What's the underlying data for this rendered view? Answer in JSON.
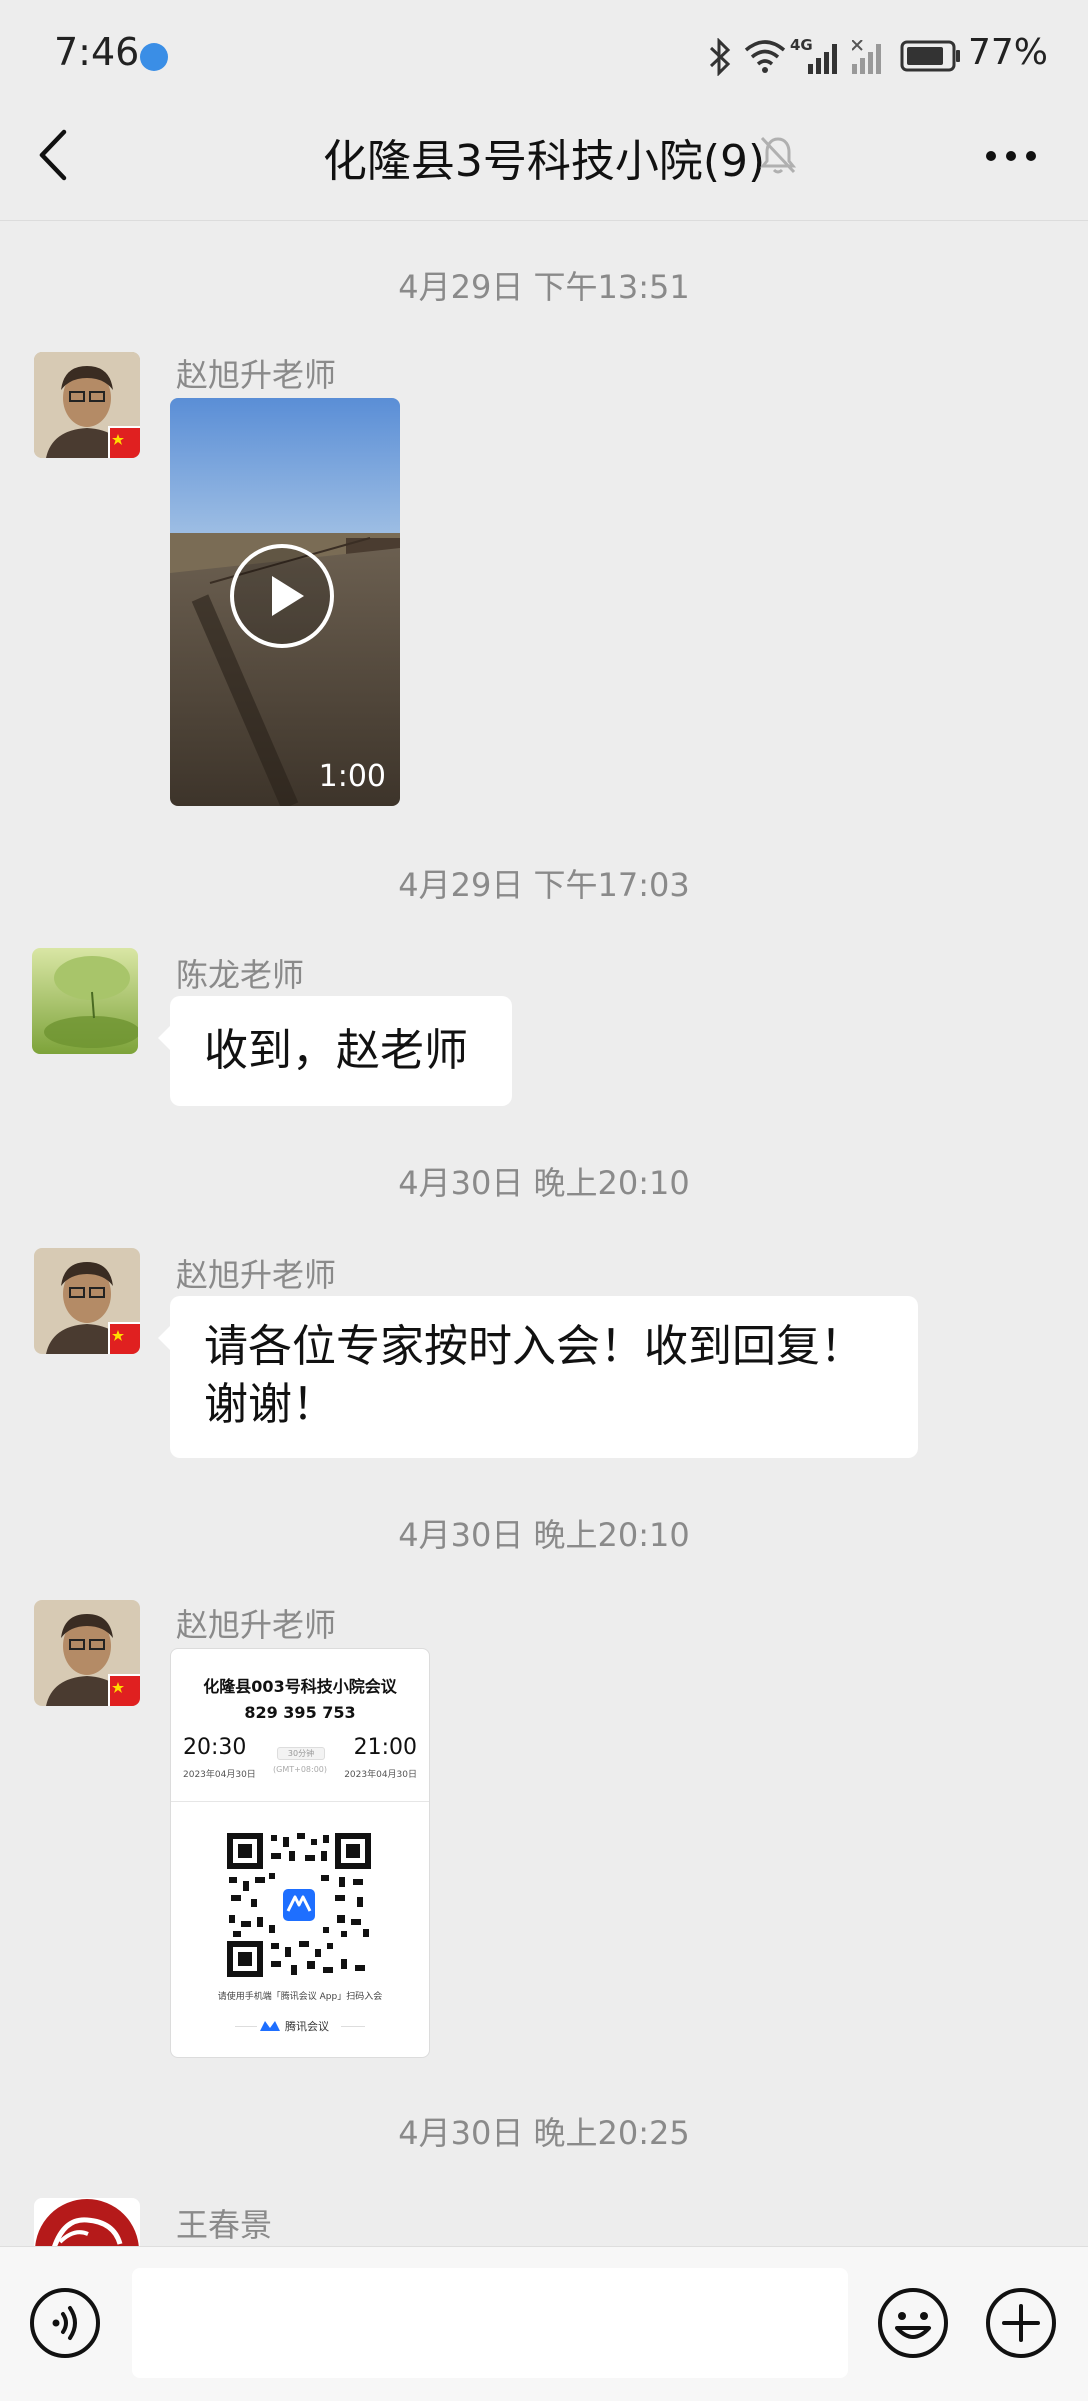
{
  "status_bar": {
    "time": "7:46",
    "network": "4G",
    "battery": "77%"
  },
  "nav": {
    "title": "化隆县3号科技小院(9)"
  },
  "messages": [
    {
      "type": "timestamp",
      "text": "4月29日 下午13:51"
    },
    {
      "type": "video",
      "sender": "赵旭升老师",
      "duration": "1:00"
    },
    {
      "type": "timestamp",
      "text": "4月29日 下午17:03"
    },
    {
      "type": "text",
      "sender": "陈龙老师",
      "text": "收到，赵老师"
    },
    {
      "type": "timestamp",
      "text": "4月30日 晚上20:10"
    },
    {
      "type": "text",
      "sender": "赵旭升老师",
      "line1": "请各位专家按时入会！收到回复！",
      "line2": "谢谢！"
    },
    {
      "type": "timestamp",
      "text": "4月30日 晚上20:10"
    },
    {
      "type": "meeting_card",
      "sender": "赵旭升老师",
      "card": {
        "title": "化隆县003号科技小院会议",
        "meeting_id": "829 395 753",
        "start_time": "20:30",
        "end_time": "21:00",
        "start_date": "2023年04月30日",
        "end_date": "2023年04月30日",
        "duration": "30分钟",
        "timezone": "(GMT+08:00)",
        "scan_hint": "请使用手机端「腾讯会议 App」扫码入会",
        "brand": "腾讯会议"
      }
    },
    {
      "type": "timestamp",
      "text": "4月30日 晚上20:25"
    },
    {
      "type": "partial",
      "sender": "王春景"
    }
  ],
  "colors": {
    "background": "#ededed",
    "bubble": "#ffffff",
    "timestamp": "#8a8a8a",
    "meeting_blue": "#1e6fff"
  }
}
